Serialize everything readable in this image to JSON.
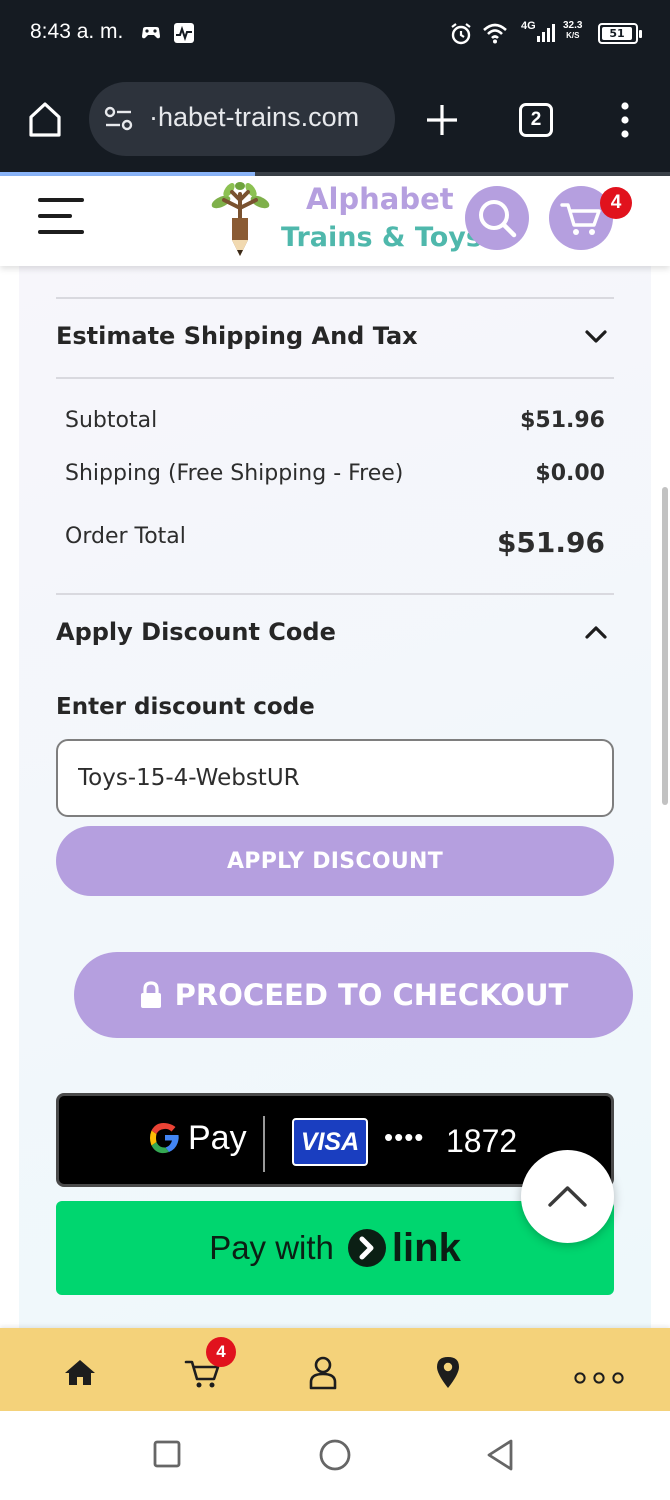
{
  "status_bar": {
    "time": "8:43 a. m.",
    "network": "4G",
    "speed_value": "32.3",
    "speed_unit": "K/S",
    "battery": "51"
  },
  "browser": {
    "url": "·habet-trains.com",
    "tab_count": "2",
    "icons": [
      "home-icon",
      "site-settings-icon",
      "plus-icon",
      "tabs-icon",
      "overflow-menu-icon"
    ],
    "page_load_progress_pct": 38
  },
  "site_header": {
    "logo_line1": "Alphabet",
    "logo_line2": "Trains & Toys",
    "cart_count": "4",
    "brand_purple": "#b59fdf",
    "brand_teal": "#4fb8ac"
  },
  "cart_summary": {
    "estimate_title": "Estimate Shipping And Tax",
    "estimate_expanded": false,
    "rows": [
      {
        "label": "Subtotal",
        "value": "$51.96"
      },
      {
        "label": "Shipping (Free Shipping - Free)",
        "value": "$0.00"
      }
    ],
    "order_total_label": "Order Total",
    "order_total_value": "$51.96"
  },
  "discount": {
    "title": "Apply Discount Code",
    "expanded": true,
    "field_label": "Enter discount code",
    "code_value": "Toys-15-4-WebstUR",
    "apply_label": "APPLY DISCOUNT"
  },
  "checkout": {
    "proceed_label": "PROCEED TO CHECKOUT"
  },
  "payments": {
    "gpay_word": "Pay",
    "card_brand": "VISA",
    "card_mask": "••••",
    "card_last4": "1872",
    "link_prefix": "Pay with",
    "link_word": "link",
    "link_color": "#00d66f"
  },
  "bottom_nav": {
    "items": [
      "home-icon",
      "cart-icon",
      "account-icon",
      "location-icon",
      "more-icon"
    ],
    "cart_count": "4",
    "bg_color": "#f4d27a"
  }
}
